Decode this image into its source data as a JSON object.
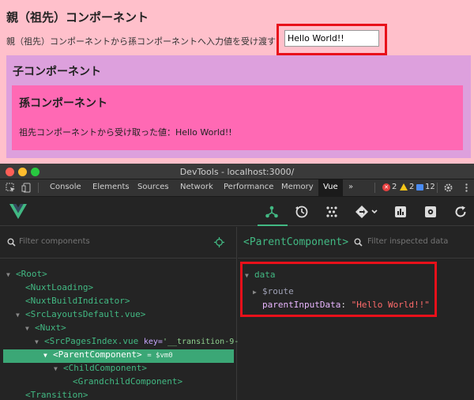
{
  "app": {
    "parent_title": "親（祖先）コンポーネント",
    "parent_label": "親（祖先）コンポーネントから孫コンポーネントへ入力値を受け渡す：",
    "input_value": "Hello World!!",
    "child_title": "子コンポーネント",
    "grandchild_title": "孫コンポーネント",
    "grandchild_label": "祖先コンポーネントから受け取った値：",
    "grandchild_value": "Hello World!!",
    "colors": {
      "parent_bg": "#ffc0cb",
      "child_bg": "#dda0dd",
      "grandchild_bg": "#ff69b4",
      "highlight": "#e8101a"
    }
  },
  "window": {
    "title": "DevTools - localhost:3000/"
  },
  "devtools_tabs": [
    "Console",
    "Elements",
    "Sources",
    "Network",
    "Performance",
    "Memory",
    "Vue"
  ],
  "active_tab": "Vue",
  "more_tabs": "»",
  "status": {
    "errors": "2",
    "warnings": "2",
    "info": "12"
  },
  "components_panel": {
    "filter_placeholder": "Filter components",
    "tree": [
      {
        "tag": "<Root>",
        "arrow": "▼"
      },
      {
        "tag": "<NuxtLoading>",
        "arrow": ""
      },
      {
        "tag": "<NuxtBuildIndicator>",
        "arrow": ""
      },
      {
        "tag": "<SrcLayoutsDefault.vue>",
        "arrow": "▼"
      },
      {
        "tag": "<Nuxt>",
        "arrow": "▼"
      },
      {
        "tag": "<SrcPagesIndex.vue",
        "arrow": "▼",
        "attr": "key=",
        "attrval": "'__transition-9-"
      },
      {
        "tag": "<ParentComponent>",
        "arrow": "▼",
        "vm": "= $vm0",
        "selected": true
      },
      {
        "tag": "<ChildComponent>",
        "arrow": "▼"
      },
      {
        "tag": "<GrandchildComponent>",
        "arrow": ""
      },
      {
        "tag": "<Transition>",
        "arrow": ""
      }
    ]
  },
  "inspector": {
    "title": "<ParentComponent>",
    "filter_placeholder": "Filter inspected data",
    "section": "data",
    "section_arrow": "▼",
    "route_arrow": "▶",
    "route_key": "$route",
    "prop_key": "parentInputData",
    "prop_value": "\"Hello World!!\""
  },
  "icons": [
    "select-element-icon",
    "device-toggle-icon",
    "settings-gear-icon",
    "kebab-menu-icon",
    "vue-logo-icon",
    "components-icon",
    "timeline-icon",
    "performance-icon",
    "routing-icon",
    "chart-icon",
    "settings-icon",
    "refresh-icon",
    "search-icon",
    "target-icon"
  ]
}
